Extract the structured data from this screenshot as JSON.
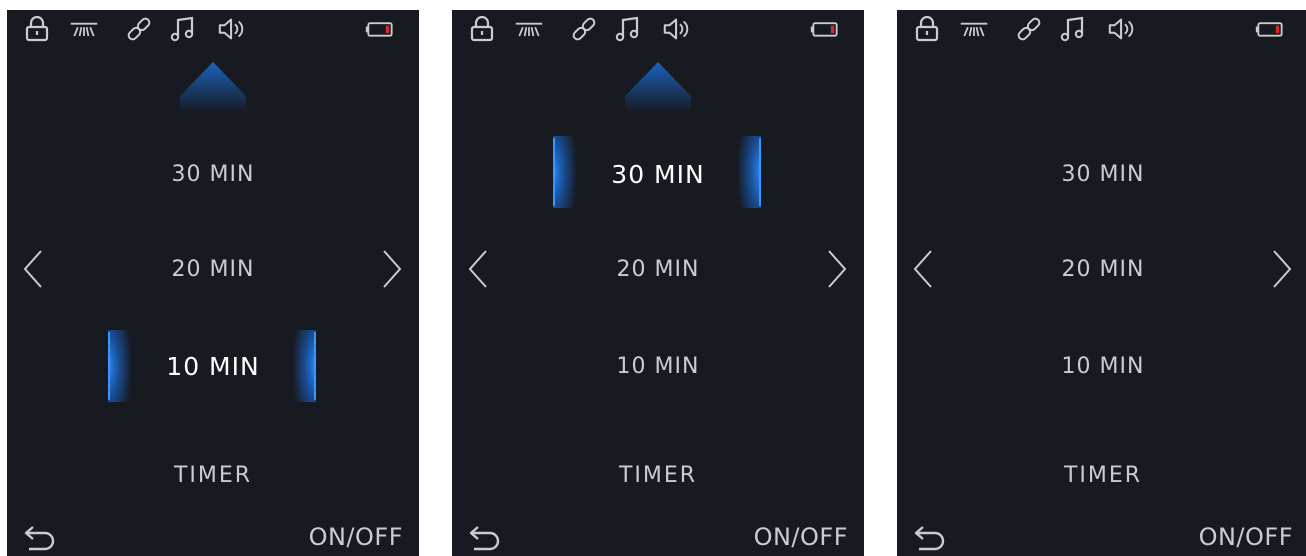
{
  "colors": {
    "background": "#181a22",
    "text": "#c9ccd3",
    "selected_text": "#ffffff",
    "accent_glow": "#1a7cf0",
    "battery_low": "#e0262a"
  },
  "status_icons": [
    "lock-icon",
    "fan-icon",
    "link-icon",
    "music-note-icon",
    "speaker-icon",
    "battery-low-icon"
  ],
  "screens": [
    {
      "options": [
        "30 MIN",
        "20 MIN",
        "10 MIN"
      ],
      "selected": "10 MIN",
      "show_up_arrow": true,
      "show_side_arrows": true,
      "title": "TIMER",
      "onoff_label": "ON/OFF"
    },
    {
      "options": [
        "30 MIN",
        "20 MIN",
        "10 MIN"
      ],
      "selected": "30 MIN",
      "show_up_arrow": true,
      "show_side_arrows": true,
      "title": "TIMER",
      "onoff_label": "ON/OFF"
    },
    {
      "options": [
        "30 MIN",
        "20 MIN",
        "10 MIN"
      ],
      "selected": "",
      "show_up_arrow": false,
      "show_side_arrows": true,
      "title": "TIMER",
      "onoff_label": "ON/OFF"
    }
  ]
}
